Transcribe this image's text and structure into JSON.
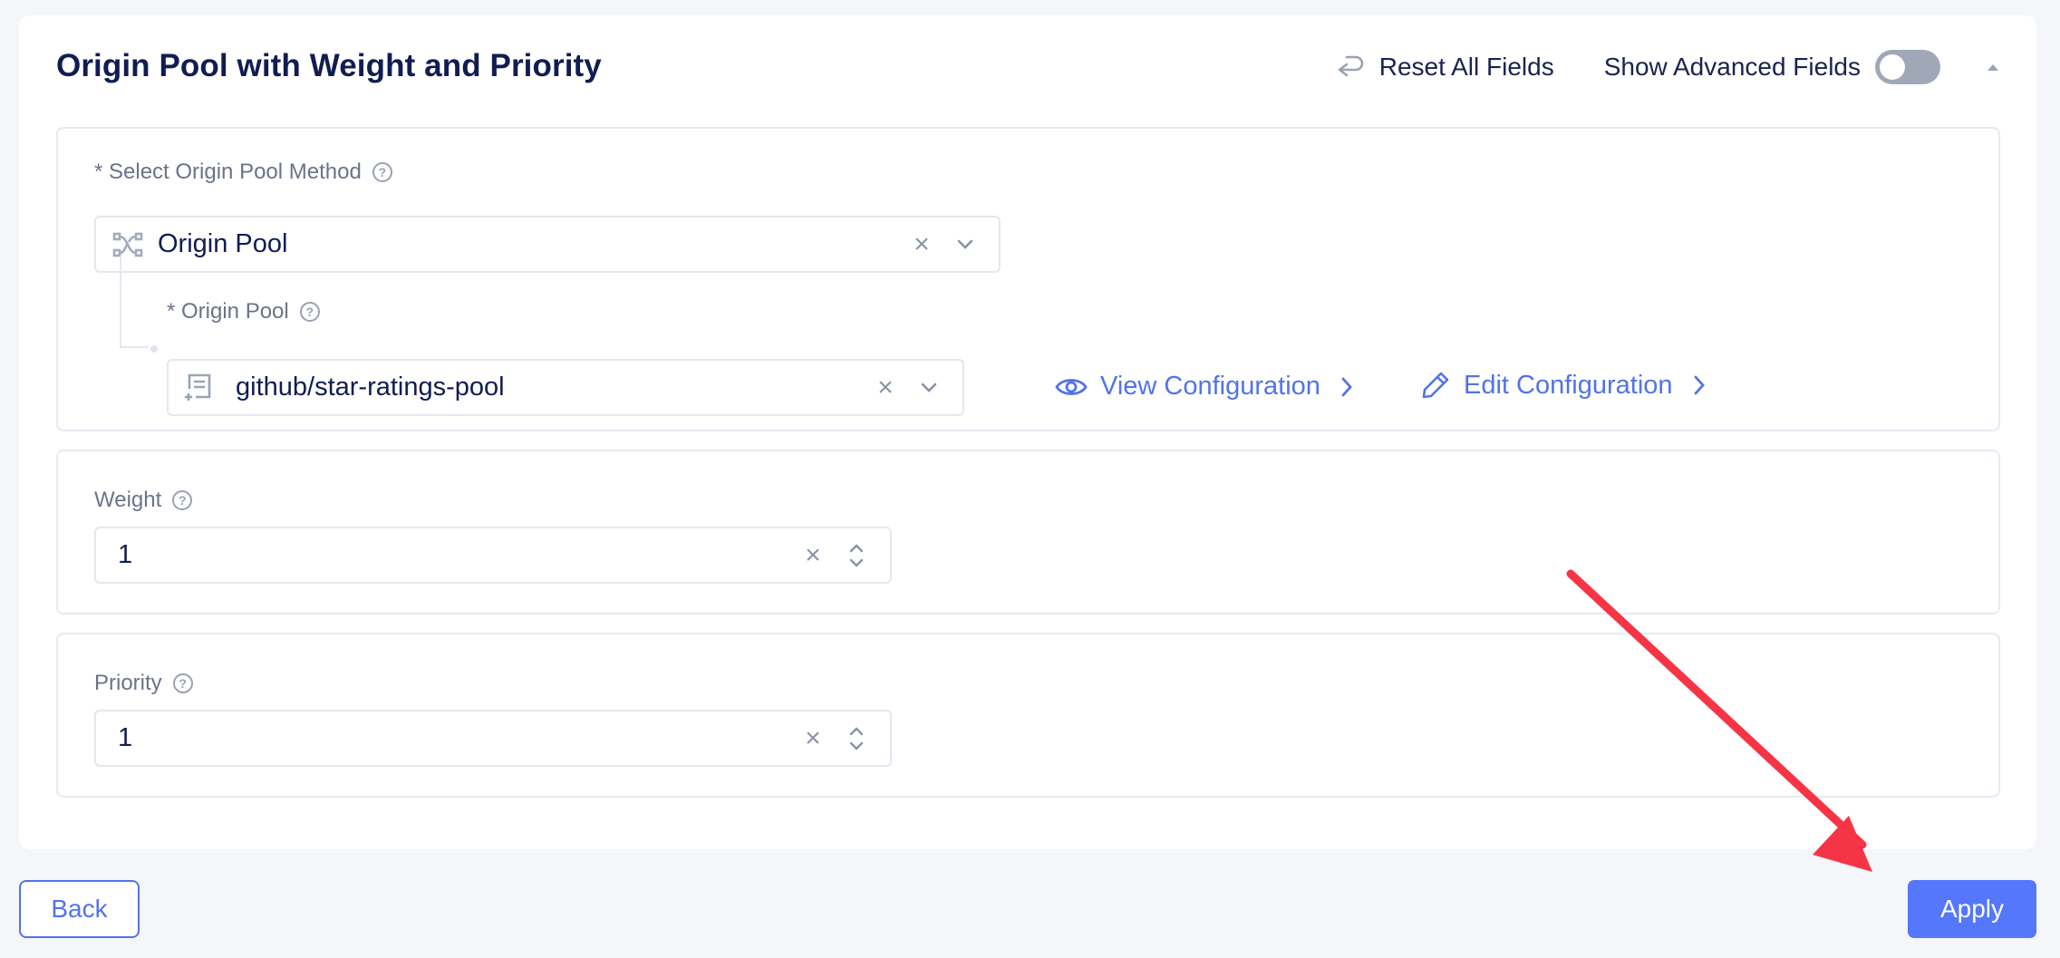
{
  "header": {
    "title": "Origin Pool with Weight and Priority",
    "reset_label": "Reset All Fields",
    "advanced_label": "Show Advanced Fields",
    "advanced_enabled": false
  },
  "origin_method": {
    "label": "* Select Origin Pool Method",
    "value": "Origin Pool",
    "icon": "network-icon"
  },
  "origin_pool": {
    "label": "* Origin Pool",
    "value": "github/star-ratings-pool",
    "icon": "list-add-icon",
    "view_label": "View Configuration",
    "edit_label": "Edit Configuration"
  },
  "weight": {
    "label": "Weight",
    "value": "1"
  },
  "priority": {
    "label": "Priority",
    "value": "1"
  },
  "footer": {
    "back_label": "Back",
    "apply_label": "Apply"
  },
  "colors": {
    "accent": "#5477fb",
    "link": "#5273ea",
    "title": "#111d52",
    "annotation_arrow": "#f53546"
  },
  "icons": {
    "clear": "×",
    "help": "?"
  }
}
